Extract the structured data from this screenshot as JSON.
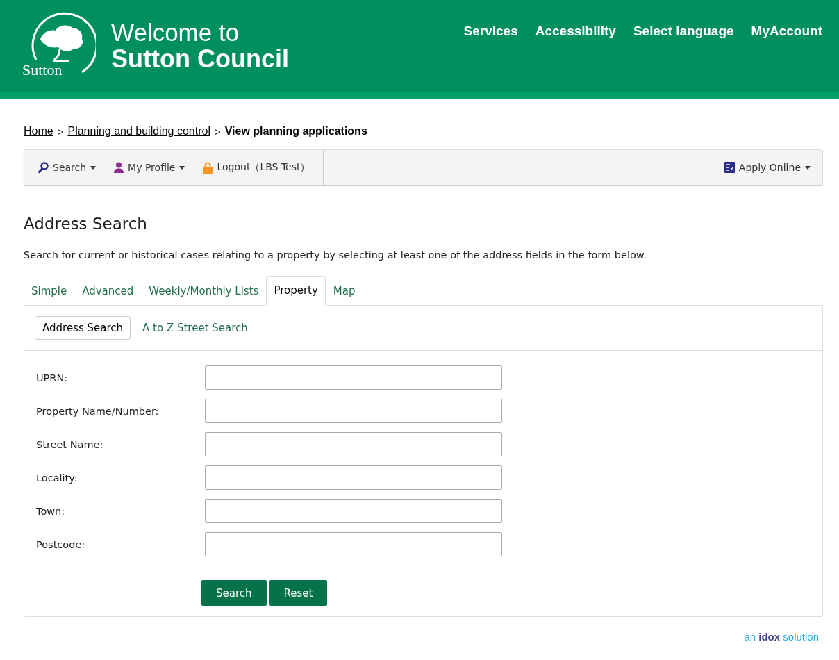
{
  "header": {
    "logo_text": "Sutton",
    "title_line_1": "Welcome to",
    "title_line_2": "Sutton Council",
    "nav": [
      "Services",
      "Accessibility",
      "Select language",
      "MyAccount"
    ]
  },
  "breadcrumb": [
    {
      "label": "Home",
      "kind": "link"
    },
    {
      "label": "Planning and building control",
      "kind": "link"
    },
    {
      "label": "View planning applications",
      "kind": "current"
    }
  ],
  "breadcrumb_separator": ">",
  "toolbar": {
    "left": [
      {
        "label": "Search",
        "kind": "search",
        "dropdown": true
      },
      {
        "label": "My Profile",
        "kind": "profile",
        "dropdown": true
      },
      {
        "label": "Logout（LBS Test）",
        "kind": "logout",
        "dropdown": false
      }
    ],
    "right": {
      "label": "Apply Online",
      "kind": "apply",
      "dropdown": true
    }
  },
  "page_title": "Address Search",
  "intro": "Search for current or historical cases relating to a property by selecting at least one of the address fields in the form below.",
  "tabs": [
    {
      "label": "Simple",
      "selected": false
    },
    {
      "label": "Advanced",
      "selected": false
    },
    {
      "label": "Weekly/Monthly Lists",
      "selected": false
    },
    {
      "label": "Property",
      "selected": true
    },
    {
      "label": "Map",
      "selected": false
    }
  ],
  "subtabs": [
    {
      "label": "Address Search",
      "selected": true
    },
    {
      "label": "A to Z Street Search",
      "selected": false
    }
  ],
  "fields": [
    {
      "label": "UPRN:"
    },
    {
      "label": "Property Name/Number:"
    },
    {
      "label": "Street Name:"
    },
    {
      "label": "Locality:"
    },
    {
      "label": "Town:"
    },
    {
      "label": "Postcode:"
    }
  ],
  "buttons": [
    "Search",
    "Reset"
  ],
  "footer": "an **idox** solution"
}
